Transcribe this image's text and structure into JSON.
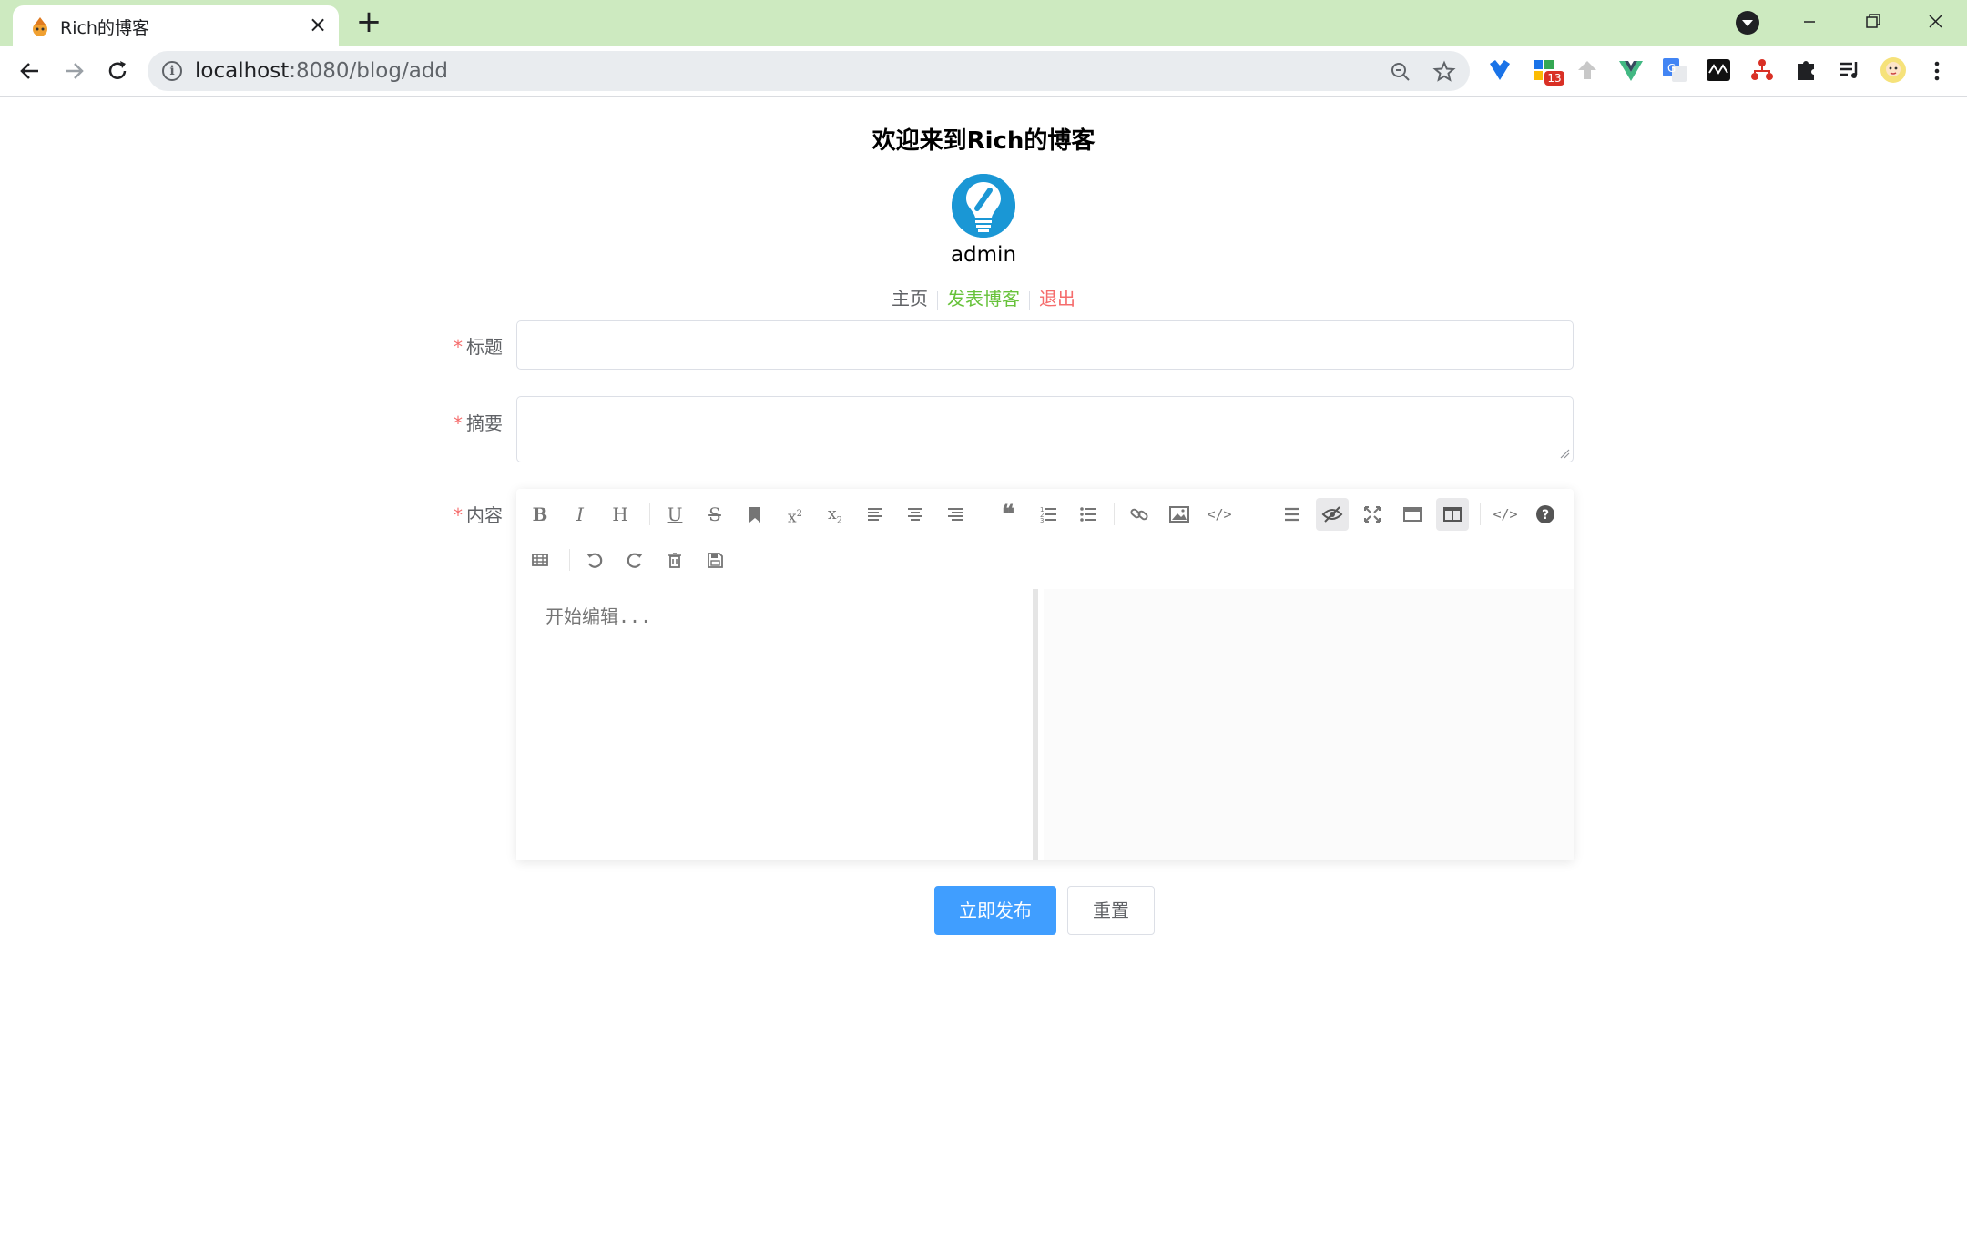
{
  "browser": {
    "tab_title": "Rich的博客",
    "url_host": "localhost",
    "url_rest": ":8080/blog/add",
    "extension_badge": "13",
    "colors": {
      "tabstrip": "#cdeac0",
      "omnibox": "#e9ecef"
    }
  },
  "header": {
    "welcome": "欢迎来到Rich的博客",
    "username": "admin",
    "avatar_icon": "lightbulb-icon"
  },
  "nav_links": {
    "home": "主页",
    "post": "发表博客",
    "logout": "退出",
    "colors": {
      "home": "#606266",
      "post": "#67c23a",
      "logout": "#f56c6c"
    }
  },
  "form": {
    "required_mark": "*",
    "title_label": "标题",
    "title_value": "",
    "summary_label": "摘要",
    "summary_value": "",
    "content_label": "内容",
    "editor_placeholder": "开始编辑...",
    "toolbar_buttons": [
      "bold",
      "italic",
      "header",
      "underline",
      "strikethrough",
      "mark",
      "superscript",
      "subscript",
      "align-left",
      "align-center",
      "align-right",
      "quote",
      "ordered-list",
      "unordered-list",
      "link",
      "image",
      "code",
      "navigation",
      "preview",
      "fullscreen",
      "read-mode",
      "subfield",
      "html-code",
      "help",
      "table",
      "undo",
      "redo",
      "trash",
      "save"
    ],
    "submit_label": "立即发布",
    "reset_label": "重置",
    "accent_color": "#409eff"
  }
}
